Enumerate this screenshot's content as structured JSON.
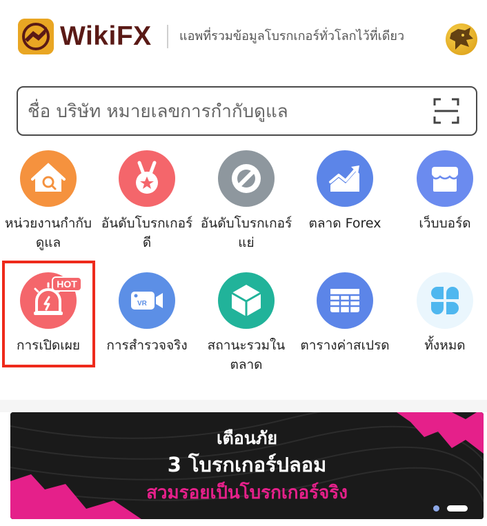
{
  "header": {
    "brand": "WikiFX",
    "slogan": "แอพที่รวมข้อมูลโบรกเกอร์ทั่วโลกไว้ที่เดียว"
  },
  "search": {
    "placeholder": "ชื่อ บริษัท หมายเลขการกำกับดูแล"
  },
  "menu": {
    "row1": [
      {
        "label": "หน่วยงานกำกับดูแล",
        "icon": "regulator-house-icon",
        "color": "#f5923e"
      },
      {
        "label": "อันดับโบรกเกอร์ดี",
        "icon": "medal-icon",
        "color": "#f4666b"
      },
      {
        "label": "อันดับโบรกเกอร์แย่",
        "icon": "ban-icon",
        "color": "#8e979e"
      },
      {
        "label": "ตลาด Forex",
        "icon": "trend-chart-icon",
        "color": "#5c85e8"
      },
      {
        "label": "เว็บบอร์ด",
        "icon": "store-icon",
        "color": "#6b8bef"
      }
    ],
    "row2": [
      {
        "label": "การเปิดเผย",
        "icon": "alarm-siren-icon",
        "color": "#f4666b",
        "badge": "HOT"
      },
      {
        "label": "การสำรวจจริง",
        "icon": "vr-camera-icon",
        "color": "#5c8fe6"
      },
      {
        "label": "สถานะรวมในตลาด",
        "icon": "cube-icon",
        "color": "#21b39a"
      },
      {
        "label": "ตารางค่าสเปรด",
        "icon": "table-grid-icon",
        "color": "#5c85e8"
      },
      {
        "label": "ทั้งหมด",
        "icon": "clover-grid-icon",
        "color": "#4fb7ef"
      }
    ]
  },
  "banner": {
    "line1": "เตือนภัย",
    "line2": "3 โบรกเกอร์ปลอม",
    "line3": "สวมรอยเป็นโบรกเกอร์จริง",
    "accent": "#e5208a"
  }
}
